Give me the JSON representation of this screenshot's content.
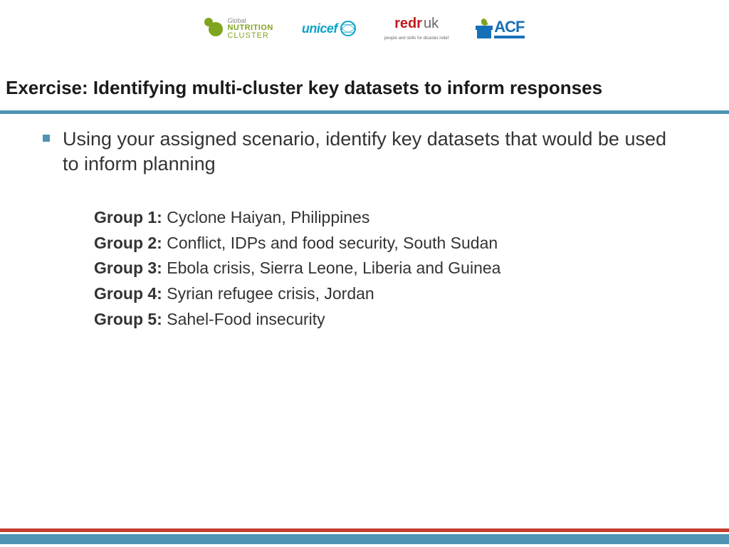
{
  "logos": {
    "gnc": {
      "line1": "Global",
      "line2": "NUTRITION",
      "line3": "CLUSTER"
    },
    "unicef": {
      "text": "unicef"
    },
    "redr": {
      "red": "redr",
      "uk": "uk",
      "sub": "people and skills for disaster relief"
    },
    "acf": {
      "text": "ACF"
    }
  },
  "title": "Exercise:  Identifying multi-cluster key datasets to inform responses",
  "lead": "Using your assigned scenario, identify key datasets that would be used to inform planning",
  "groups": [
    {
      "label": "Group 1:",
      "text": "  Cyclone Haiyan, Philippines"
    },
    {
      "label": "Group 2:",
      "text": "  Conflict, IDPs and food security, South Sudan"
    },
    {
      "label": "Group 3:",
      "text": "  Ebola crisis, Sierra Leone, Liberia and Guinea"
    },
    {
      "label": "Group 4:",
      "text": "  Syrian refugee crisis, Jordan"
    },
    {
      "label": "Group 5:",
      "text": "  Sahel-Food insecurity"
    }
  ]
}
